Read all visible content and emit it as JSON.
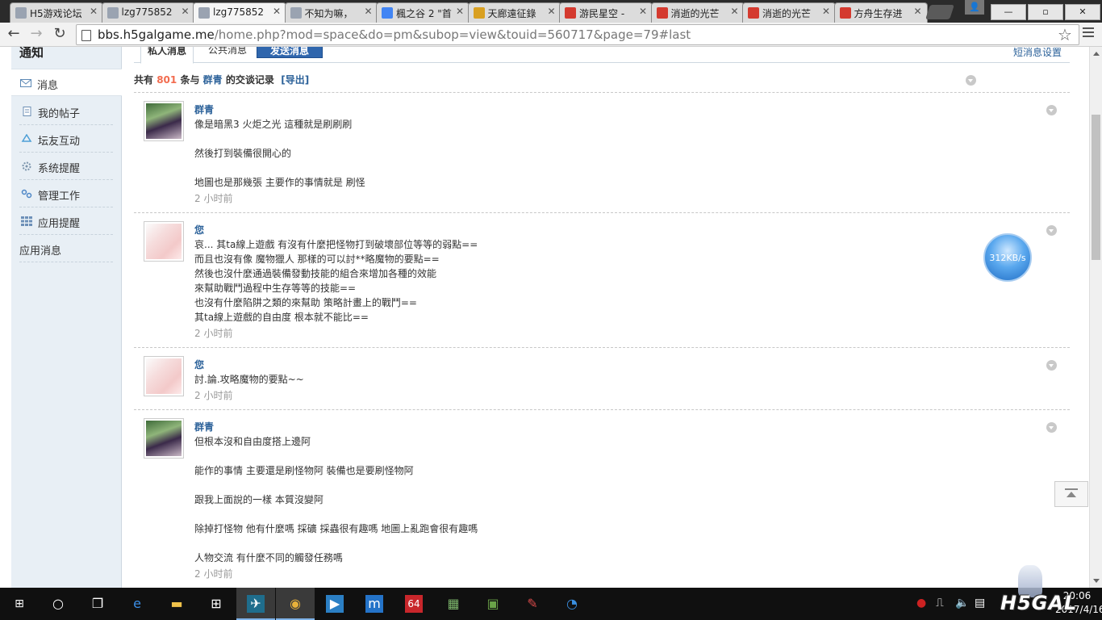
{
  "browser": {
    "tabs": [
      {
        "title": "H5游戏论坛",
        "fav": "#9aa3b1",
        "active": false
      },
      {
        "title": "lzg775852",
        "fav": "#9aa3b1",
        "active": false
      },
      {
        "title": "lzg775852",
        "fav": "#9aa3b1",
        "active": true
      },
      {
        "title": "不知为嘛，",
        "fav": "#9aa3b1",
        "active": false
      },
      {
        "title": "楓之谷 2 \"首",
        "fav": "#4285f4",
        "active": false
      },
      {
        "title": "天廊遠征錄",
        "fav": "#d9a021",
        "active": false
      },
      {
        "title": "游民星空 -",
        "fav": "#d43a2f",
        "active": false
      },
      {
        "title": "消逝的光芒",
        "fav": "#d43a2f",
        "active": false
      },
      {
        "title": "消逝的光芒",
        "fav": "#d43a2f",
        "active": false
      },
      {
        "title": "方舟生存进",
        "fav": "#d43a2f",
        "active": false
      }
    ],
    "url_host": "bbs.h5galgame.me",
    "url_path": "/home.php?mod=space&do=pm&subop=view&touid=560717&page=79#last"
  },
  "sidebar": {
    "heading": "通知",
    "items": [
      {
        "label": "消息",
        "icon": "envelope-icon"
      },
      {
        "label": "我的帖子",
        "icon": "document-icon"
      },
      {
        "label": "坛友互动",
        "icon": "recycle-icon"
      },
      {
        "label": "系统提醒",
        "icon": "gear-icon"
      },
      {
        "label": "管理工作",
        "icon": "link-icon"
      },
      {
        "label": "应用提醒",
        "icon": "grid-icon"
      },
      {
        "label": "应用消息",
        "icon": ""
      }
    ]
  },
  "content": {
    "tab_private": "私人消息",
    "tab_public": "公共消息",
    "send_button": "发送消息",
    "settings_link": "短消息设置",
    "summary_prefix": "共有",
    "summary_count": "801",
    "summary_mid": "条与",
    "summary_user": "群青",
    "summary_suffix": "的交谈记录",
    "export_link": "[导出]",
    "messages": [
      {
        "name": "群青",
        "avatar": "green",
        "lines": [
          "像是暗黑3  火炬之光  這種就是刷刷刷",
          "",
          "然後打到裝備很開心的",
          "",
          "地圖也是那幾張   主要作的事情就是 刷怪"
        ],
        "time": "2 小时前"
      },
      {
        "name": "您",
        "avatar": "pink",
        "lines": [
          "哀... 其ta線上遊戲 有沒有什麼把怪物打到破壞部位等等的弱點==",
          "而且也沒有像 魔物獵人 那樣的可以討**略魔物的要點==",
          "然後也沒什麼通過裝備發動技能的組合來增加各種的效能",
          "來幫助戰鬥過程中生存等等的技能==",
          "也沒有什麼陷阱之類的來幫助 策略計畫上的戰鬥==",
          "其ta線上遊戲的自由度 根本就不能比=="
        ],
        "time": "2 小时前"
      },
      {
        "name": "您",
        "avatar": "pink",
        "lines": [
          "討.論.攻略魔物的要點~~"
        ],
        "time": "2 小时前"
      },
      {
        "name": "群青",
        "avatar": "green",
        "lines": [
          "但根本沒和自由度搭上邊阿",
          "",
          "能作的事情 主要還是刷怪物阿   裝備也是要刷怪物阿",
          "",
          "跟我上面說的一樣 本質沒變阿",
          "",
          "除掉打怪物   他有什麼嗎   採礦 採蟲很有趣嗎   地圖上亂跑會很有趣嗎",
          "",
          "人物交流   有什麼不同的觸發任務嗎"
        ],
        "time": "2 小时前"
      }
    ]
  },
  "overlay": {
    "speed": "312KB/s"
  },
  "taskbar": {
    "apps": [
      "search-icon",
      "task-view-icon",
      "edge-icon",
      "file-explorer-icon",
      "store-icon",
      "app-bird-icon",
      "chrome-icon",
      "video-player-icon",
      "app-m-icon",
      "app-64-icon",
      "books-icon",
      "minecraft-icon",
      "paint-icon",
      "media-icon"
    ],
    "clock_time": "20:06",
    "clock_date": "2017/4/16",
    "logo_text": "H5GAL"
  }
}
